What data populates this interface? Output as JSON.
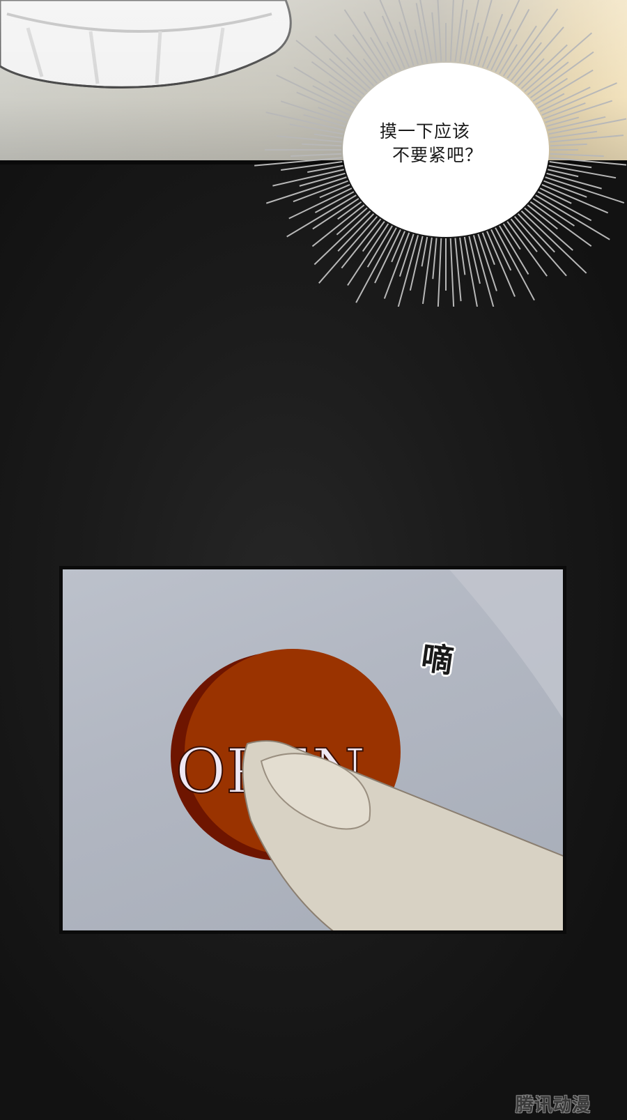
{
  "speech_bubble": {
    "line1": "摸一下应该",
    "line2": "不要紧吧？"
  },
  "sound_effect": "嘀",
  "button_label": "OPEN",
  "watermark": "腾讯动漫",
  "colors": {
    "button": "#9a3300",
    "button_rim": "#6e1500",
    "background": "#141414"
  }
}
